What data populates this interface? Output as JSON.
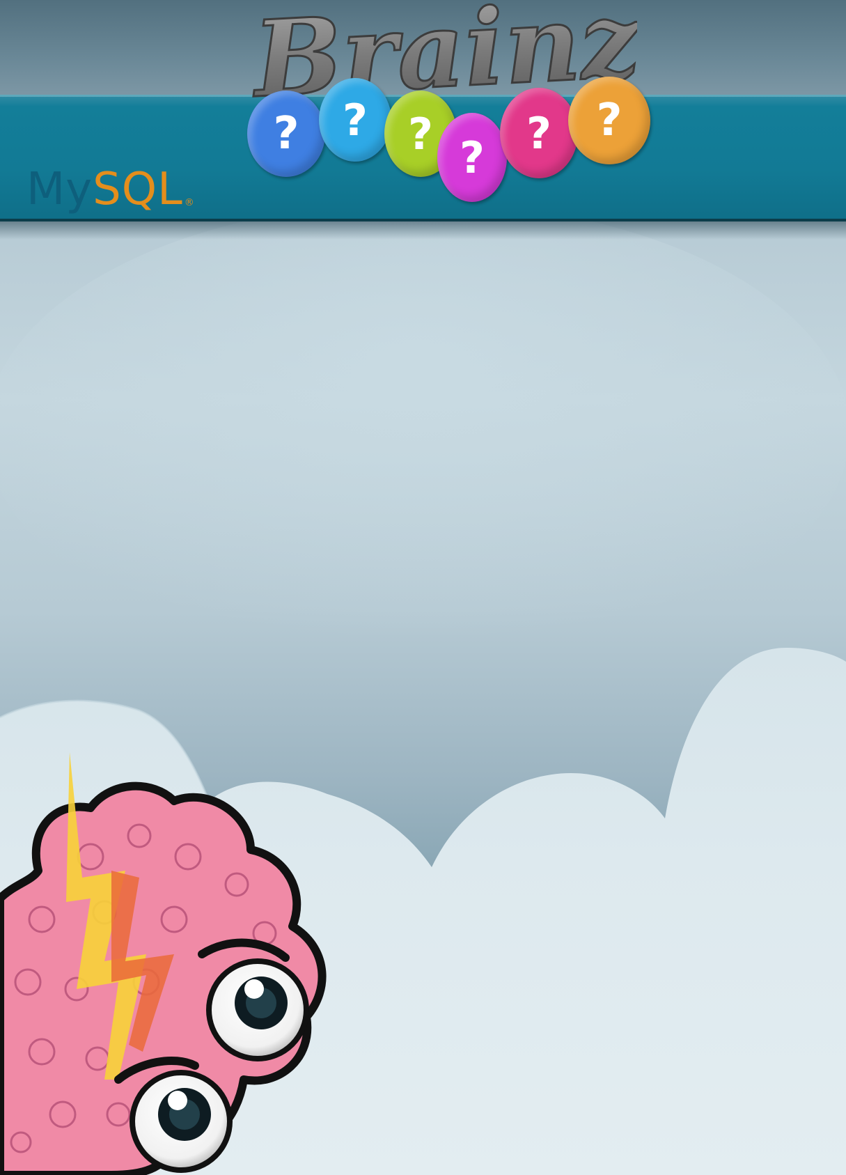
{
  "header": {
    "game_title": "Brainz",
    "brand_logo_text": {
      "my": "My",
      "sql": "SQL",
      "registered": "®"
    }
  },
  "balloons": [
    {
      "symbol": "?",
      "color": "#3f7fe2"
    },
    {
      "symbol": "?",
      "color": "#2ea9e6"
    },
    {
      "symbol": "?",
      "color": "#a8cf27"
    },
    {
      "symbol": "?",
      "color": "#d63ad9"
    },
    {
      "symbol": "?",
      "color": "#e2388a"
    },
    {
      "symbol": "?",
      "color": "#eca138"
    }
  ],
  "mascot": {
    "name": "brain-mascot-icon"
  },
  "colors": {
    "banner": "#127a95",
    "sky": "#b6cad4",
    "cloud": "#dbe7ec",
    "brain_pink": "#f08aa6"
  }
}
